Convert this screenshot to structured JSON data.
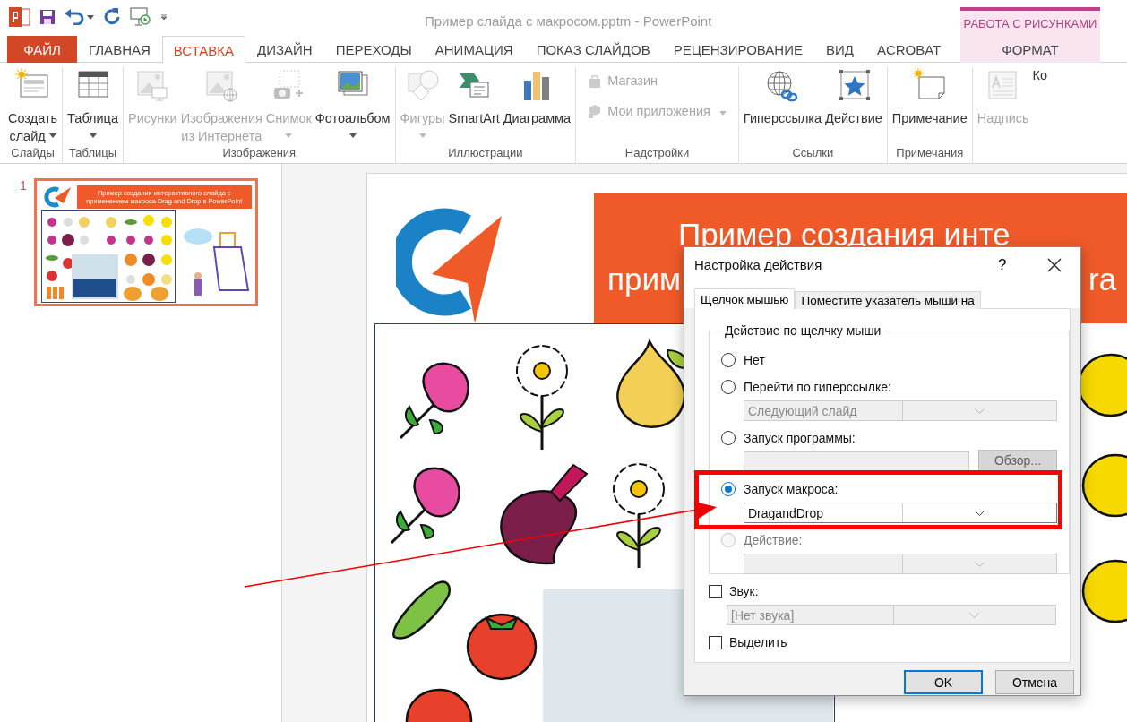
{
  "title_bar": {
    "title": "Пример слайда с макросом.pptm - PowerPoint",
    "context_label": "РАБОТА С РИСУНКАМИ"
  },
  "tabs": [
    {
      "label": "ФАЙЛ",
      "kind": "file",
      "selected": false
    },
    {
      "label": "ГЛАВНАЯ",
      "kind": "normal",
      "selected": false
    },
    {
      "label": "ВСТАВКА",
      "kind": "normal",
      "selected": true
    },
    {
      "label": "ДИЗАЙН",
      "kind": "normal",
      "selected": false
    },
    {
      "label": "ПЕРЕХОДЫ",
      "kind": "normal",
      "selected": false
    },
    {
      "label": "АНИМАЦИЯ",
      "kind": "normal",
      "selected": false
    },
    {
      "label": "ПОКАЗ СЛАЙДОВ",
      "kind": "normal",
      "selected": false
    },
    {
      "label": "РЕЦЕНЗИРОВАНИЕ",
      "kind": "normal",
      "selected": false
    },
    {
      "label": "ВИД",
      "kind": "normal",
      "selected": false
    },
    {
      "label": "ACROBAT",
      "kind": "normal",
      "selected": false
    },
    {
      "label": "ФОРМАТ",
      "kind": "context",
      "selected": false
    }
  ],
  "ribbon": [
    {
      "label": "Слайды",
      "commands": [
        {
          "label": "Создать\nслайд",
          "kind": "large",
          "dropdown": true,
          "disabled": false
        }
      ]
    },
    {
      "label": "Таблицы",
      "commands": [
        {
          "label": "Таблица",
          "kind": "large",
          "dropdown": true,
          "disabled": false
        }
      ]
    },
    {
      "label": "Изображения",
      "commands": [
        {
          "label": "Рисунки",
          "kind": "large",
          "dropdown": false,
          "disabled": true
        },
        {
          "label": "Изображения\nиз Интернета",
          "kind": "large",
          "dropdown": false,
          "disabled": true
        },
        {
          "label": "Снимок",
          "kind": "large",
          "dropdown": true,
          "disabled": true
        },
        {
          "label": "Фотоальбом",
          "kind": "large",
          "dropdown": true,
          "disabled": false
        }
      ]
    },
    {
      "label": "Иллюстрации",
      "commands": [
        {
          "label": "Фигуры",
          "kind": "large",
          "dropdown": true,
          "disabled": true
        },
        {
          "label": "SmartArt",
          "kind": "large",
          "dropdown": false,
          "disabled": false
        },
        {
          "label": "Диаграмма",
          "kind": "large",
          "dropdown": false,
          "disabled": false
        }
      ]
    },
    {
      "label": "Надстройки",
      "commands": [
        {
          "label": "Магазин",
          "kind": "small",
          "dropdown": false,
          "disabled": true
        },
        {
          "label": "Мои приложения",
          "kind": "small",
          "dropdown": true,
          "disabled": true
        }
      ]
    },
    {
      "label": "Ссылки",
      "commands": [
        {
          "label": "Гиперссылка",
          "kind": "large",
          "dropdown": false,
          "disabled": false
        },
        {
          "label": "Действие",
          "kind": "large",
          "dropdown": false,
          "disabled": false
        }
      ]
    },
    {
      "label": "Примечания",
      "commands": [
        {
          "label": "Примечание",
          "kind": "large",
          "dropdown": false,
          "disabled": false
        }
      ]
    },
    {
      "commands": [
        {
          "label": "Надпись",
          "kind": "large",
          "dropdown": false,
          "disabled": true
        },
        {
          "label": "Ко",
          "kind": "large",
          "dropdown": false,
          "disabled": false
        }
      ]
    }
  ],
  "slides": [
    {
      "number": "1",
      "selected": true,
      "title": "Пример создания интерактивного слайда с применением макроса Drag and Drop в PowerPoint"
    }
  ],
  "slide": {
    "title_line_1": "Пример создания инте",
    "title_line_2_left": "прим",
    "title_line_2_right": "ra"
  },
  "dialog": {
    "title": "Настройка действия",
    "help": "?",
    "tabs": [
      {
        "label": "Щелчок мышью",
        "selected": true
      },
      {
        "label": "Поместите указатель мыши на",
        "selected": false
      }
    ],
    "group_label": "Действие по щелчку мыши",
    "options": [
      {
        "label": "Нет",
        "selected": false,
        "disabled": false
      },
      {
        "label": "Перейти по гиперссылке:",
        "selected": false,
        "disabled": false,
        "dropdown": {
          "value": "Следующий слайд",
          "disabled": true
        }
      },
      {
        "label": "Запуск программы:",
        "selected": false,
        "disabled": false,
        "field": {
          "disabled": true
        },
        "button": {
          "label": "Обзор...",
          "disabled": true
        }
      },
      {
        "label": "Запуск макроса:",
        "selected": true,
        "disabled": false,
        "dropdown": {
          "value": "DragandDrop",
          "disabled": false
        }
      },
      {
        "label": "Действие:",
        "selected": false,
        "disabled": true,
        "dropdown": {
          "disabled": true
        }
      }
    ],
    "sound": {
      "label": "Звук:",
      "checked": false,
      "dropdown": {
        "value": "[Нет звука]",
        "disabled": true
      }
    },
    "highlight": {
      "label": "Выделить",
      "checked": false
    },
    "buttons": [
      {
        "label": "OK",
        "default": true
      },
      {
        "label": "Отмена",
        "default": false
      }
    ]
  }
}
